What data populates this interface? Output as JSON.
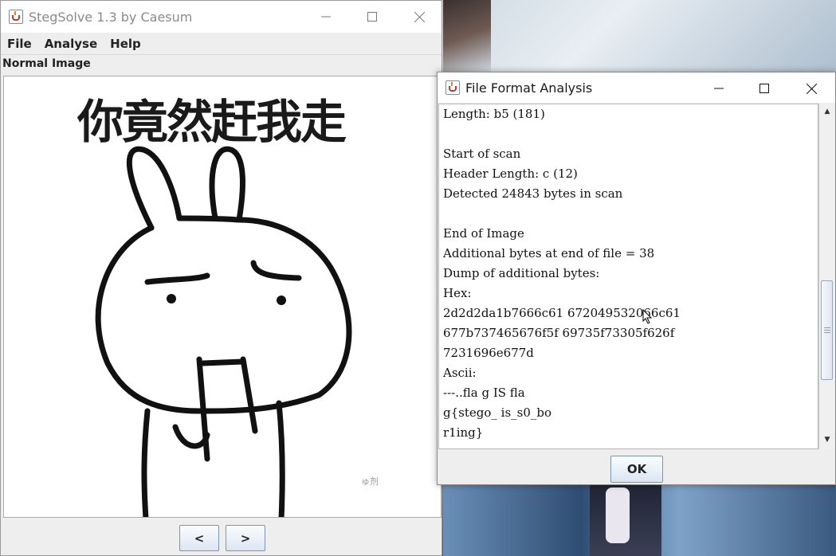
{
  "main_window": {
    "title": "StegSolve 1.3 by Caesum",
    "menu": [
      "File",
      "Analyse",
      "Help"
    ],
    "panel_label": "Normal Image",
    "image_caption": "你竟然赶我走",
    "watermark": "ゅ剂",
    "prev_label": "<",
    "next_label": ">"
  },
  "analysis_window": {
    "title": "File Format Analysis",
    "lines": [
      "Length: b5 (181)",
      "",
      "Start of scan",
      "Header Length: c (12)",
      "Detected 24843 bytes in scan",
      "",
      "End of Image",
      "Additional bytes at end of file = 38",
      "Dump of additional bytes:",
      "Hex:",
      "2d2d2da1b7666c61 672049532066c61",
      "677b737465676f5f 69735f73305f626f",
      "7231696e677d",
      "Ascii:",
      "---..fla g IS fla",
      "g{stego_ is_s0_bo",
      "r1ing}"
    ],
    "ok_label": "OK",
    "scroll_position": 0.75
  }
}
